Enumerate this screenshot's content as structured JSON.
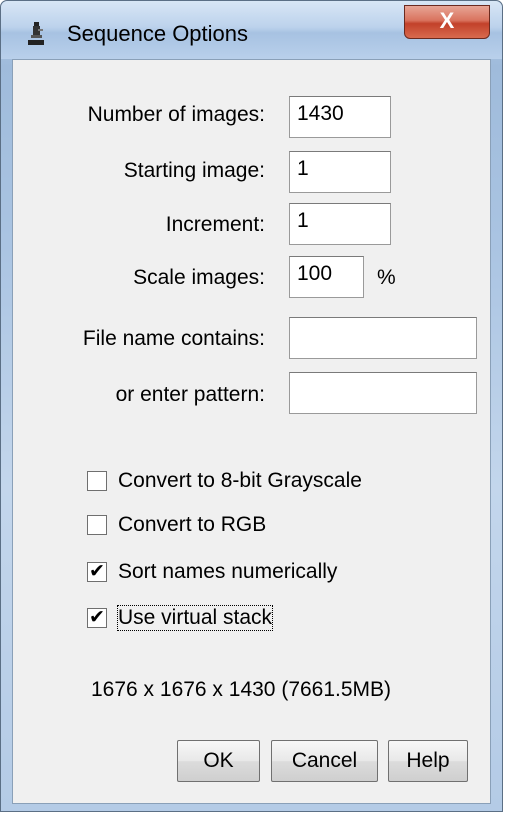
{
  "window": {
    "title": "Sequence Options",
    "close_glyph": "X",
    "app_icon": "microscope-icon"
  },
  "fields": {
    "number_of_images": {
      "label": "Number of images:",
      "value": "1430"
    },
    "starting_image": {
      "label": "Starting image:",
      "value": "1"
    },
    "increment": {
      "label": "Increment:",
      "value": "1"
    },
    "scale_images": {
      "label": "Scale images:",
      "value": "100",
      "unit": "%"
    },
    "file_name_contains": {
      "label": "File name contains:",
      "value": ""
    },
    "enter_pattern": {
      "label": "or enter pattern:",
      "value": ""
    }
  },
  "checkboxes": {
    "convert_8bit": {
      "label": "Convert to 8-bit Grayscale",
      "checked": false
    },
    "convert_rgb": {
      "label": "Convert to RGB",
      "checked": false
    },
    "sort_numerically": {
      "label": "Sort names numerically",
      "checked": true
    },
    "virtual_stack": {
      "label": "Use virtual stack",
      "checked": true
    }
  },
  "info_text": "1676 x 1676 x 1430 (7661.5MB)",
  "buttons": {
    "ok": "OK",
    "cancel": "Cancel",
    "help": "Help"
  },
  "check_glyph": "✔"
}
